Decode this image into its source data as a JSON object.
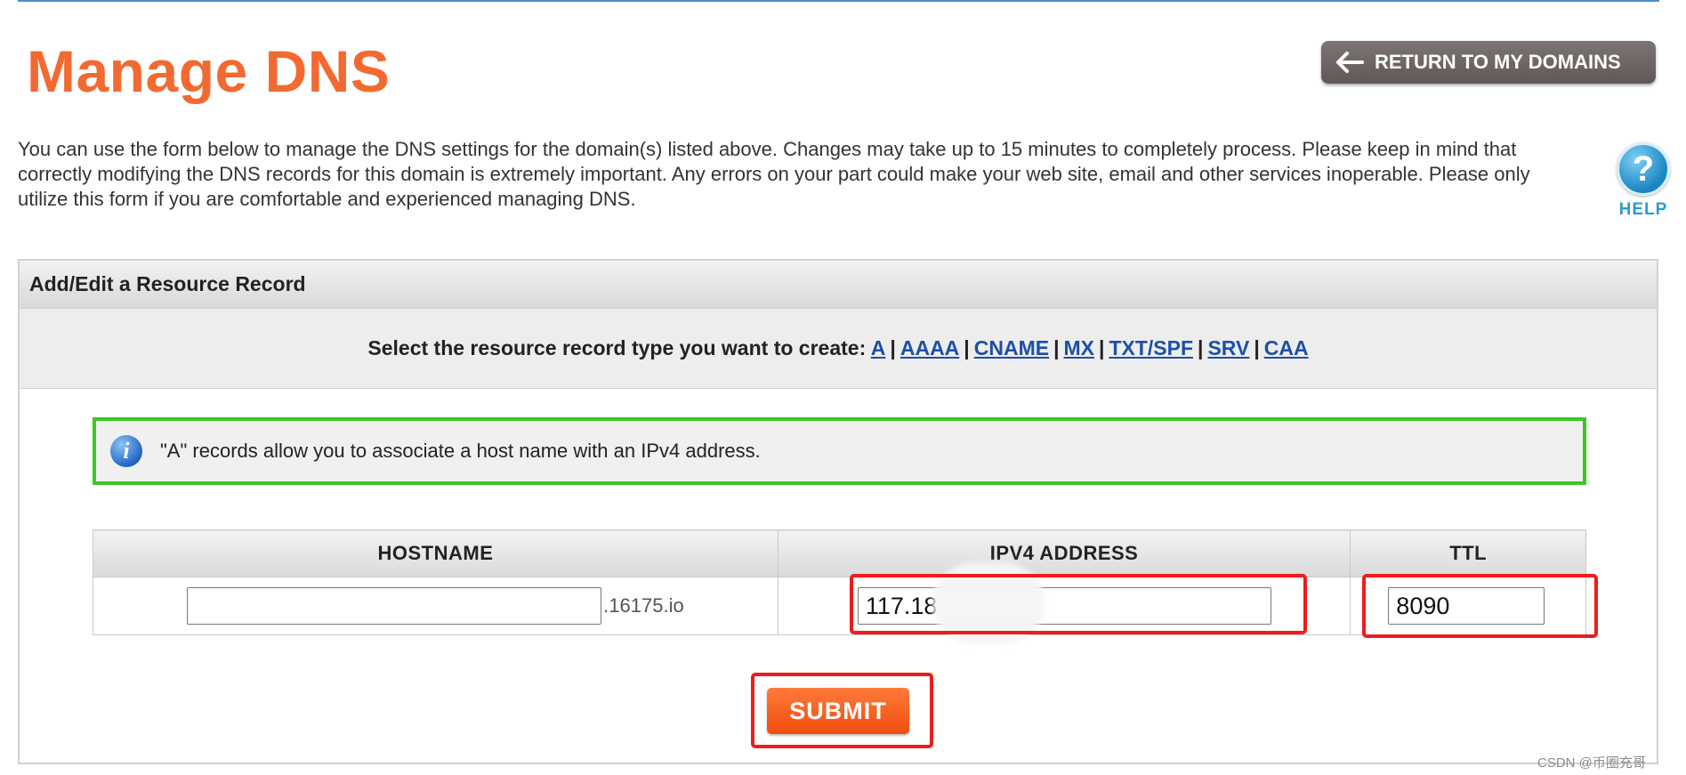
{
  "page": {
    "title": "Manage DNS",
    "return_button": "RETURN TO MY DOMAINS",
    "intro": "You can use the form below to manage the DNS settings for the domain(s) listed above. Changes may take up to 15 minutes to completely process. Please keep in mind that correctly modifying the DNS records for this domain is extremely important. Any errors on your part could make your web site, email and other services inoperable. Please only utilize this form if you are comfortable and experienced managing DNS.",
    "help_label": "HELP",
    "help_symbol": "?"
  },
  "panel": {
    "header": "Add/Edit a Resource Record",
    "type_prompt": "Select the resource record type you want to create:",
    "types": [
      "A",
      "AAAA",
      "CNAME",
      "MX",
      "TXT/SPF",
      "SRV",
      "CAA"
    ],
    "separator": "|",
    "info_icon": "i",
    "info_text": "\"A\" records allow you to associate a host name with an IPv4 address."
  },
  "table": {
    "headers": [
      "HOSTNAME",
      "IPV4 ADDRESS",
      "TTL"
    ],
    "hostname_value": "",
    "domain_suffix": ".16175.io",
    "ipv4_value": "117.18",
    "ttl_value": "8090"
  },
  "submit_label": "SUBMIT",
  "watermark": "CSDN @币圈充哥",
  "colors": {
    "title": "#f26a31",
    "link": "#1d4fa8",
    "info_border": "#3cc820",
    "highlight": "#ef1c1c",
    "submit": "#f04e0d"
  },
  "icons": {
    "return": "arrow-left-icon",
    "help": "help-icon",
    "info": "info-icon"
  }
}
